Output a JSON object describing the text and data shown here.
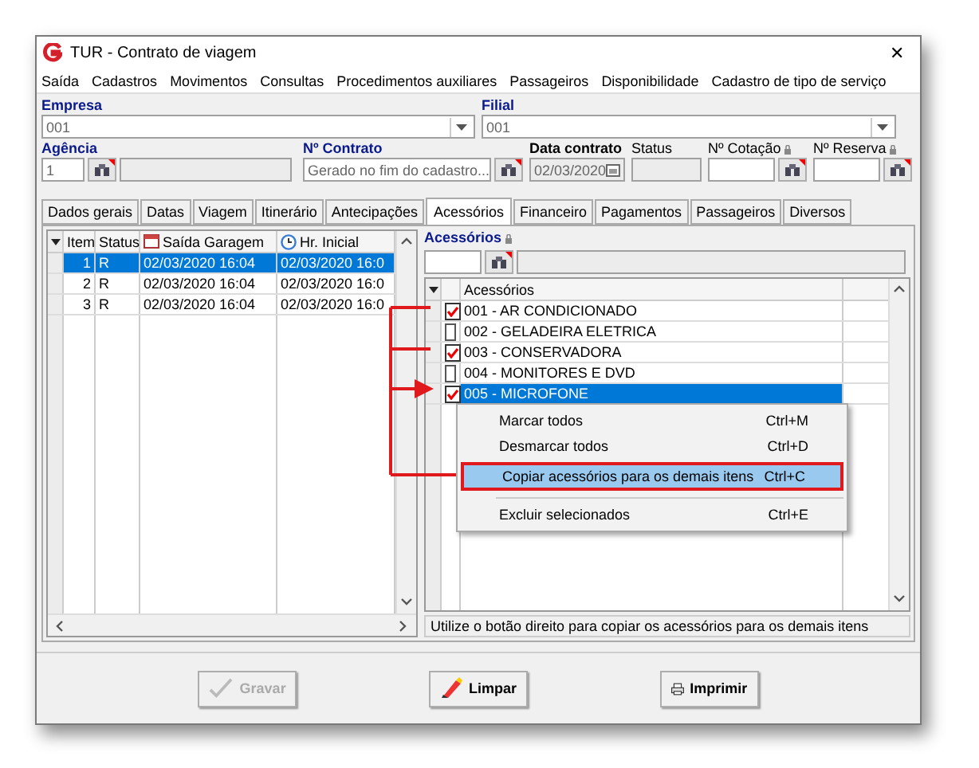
{
  "window": {
    "title": "TUR - Contrato de viagem",
    "close": "✕"
  },
  "menu": [
    "Saída",
    "Cadastros",
    "Movimentos",
    "Consultas",
    "Procedimentos auxiliares",
    "Passageiros",
    "Disponibilidade",
    "Cadastro de tipo de serviço"
  ],
  "header": {
    "empresa": {
      "label": "Empresa",
      "value": "001"
    },
    "filial": {
      "label": "Filial",
      "value": "001"
    },
    "agencia": {
      "label": "Agência",
      "value": "1"
    },
    "contrato": {
      "label": "Nº Contrato",
      "placeholder": "Gerado no fim do cadastro..."
    },
    "data_contrato": {
      "label": "Data contrato",
      "value": "02/03/2020"
    },
    "status": {
      "label": "Status"
    },
    "cotacao": {
      "label": "Nº Cotação"
    },
    "reserva": {
      "label": "Nº Reserva"
    }
  },
  "tabs": [
    {
      "label": "Dados gerais",
      "selected": false
    },
    {
      "label": "Datas",
      "selected": false
    },
    {
      "label": "Viagem",
      "selected": false
    },
    {
      "label": "Itinerário",
      "selected": false
    },
    {
      "label": "Antecipações",
      "selected": false
    },
    {
      "label": "Acessórios",
      "selected": true
    },
    {
      "label": "Financeiro",
      "selected": false
    },
    {
      "label": "Pagamentos",
      "selected": false
    },
    {
      "label": "Passageiros",
      "selected": false
    },
    {
      "label": "Diversos",
      "selected": false
    }
  ],
  "items_table": {
    "columns": [
      "Item",
      "Status",
      "Saída Garagem",
      "Hr. Inicial"
    ],
    "rows": [
      {
        "cells": [
          "1",
          "R",
          "02/03/2020 16:04",
          "02/03/2020 16:0"
        ],
        "selected": true
      },
      {
        "cells": [
          "2",
          "R",
          "02/03/2020 16:04",
          "02/03/2020 16:0"
        ],
        "selected": false
      },
      {
        "cells": [
          "3",
          "R",
          "02/03/2020 16:04",
          "02/03/2020 16:0"
        ],
        "selected": false
      }
    ]
  },
  "accessories": {
    "label": "Acessórios",
    "column": "Acessórios",
    "rows": [
      {
        "name": "001 - AR CONDICIONADO",
        "checked": true,
        "selected": false
      },
      {
        "name": "002 - GELADEIRA ELETRICA",
        "checked": false,
        "selected": false
      },
      {
        "name": "003 - CONSERVADORA",
        "checked": true,
        "selected": false
      },
      {
        "name": "004 - MONITORES E DVD",
        "checked": false,
        "selected": false
      },
      {
        "name": "005 - MICROFONE",
        "checked": true,
        "selected": true
      }
    ],
    "hint": "Utilize o botão direito para copiar os acessórios para os demais itens"
  },
  "context_menu": [
    {
      "label": "Marcar todos",
      "shortcut": "Ctrl+M",
      "selected": false
    },
    {
      "label": "Desmarcar todos",
      "shortcut": "Ctrl+D",
      "selected": false
    },
    {
      "label": "Copiar acessórios para os demais itens",
      "shortcut": "Ctrl+C",
      "selected": true
    },
    {
      "label": "Excluir selecionados",
      "shortcut": "Ctrl+E",
      "selected": false
    }
  ],
  "buttons": [
    {
      "label": "Gravar",
      "disabled": true,
      "kind": "save"
    },
    {
      "label": "Limpar",
      "disabled": false,
      "kind": "clear"
    },
    {
      "label": "Imprimir",
      "disabled": false,
      "kind": "print"
    }
  ]
}
